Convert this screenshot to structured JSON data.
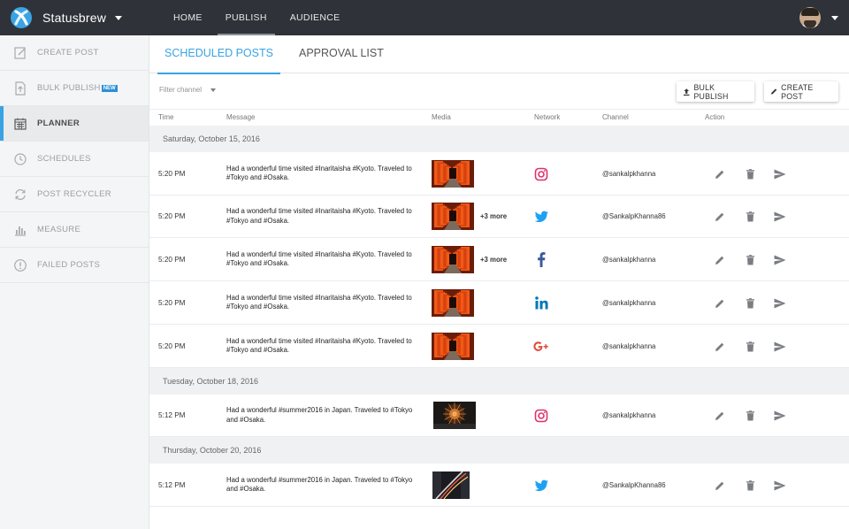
{
  "app": {
    "brand": "Statusbrew",
    "accent": "#3aa3e3",
    "nav": [
      {
        "label": "HOME"
      },
      {
        "label": "PUBLISH"
      },
      {
        "label": "AUDIENCE"
      }
    ]
  },
  "sidebar": {
    "items": [
      {
        "label": "CREATE POST",
        "icon": "edit-icon"
      },
      {
        "label": "BULK PUBLISH",
        "icon": "upload-file-icon",
        "badge": "NEW"
      },
      {
        "label": "PLANNER",
        "icon": "calendar-icon"
      },
      {
        "label": "SCHEDULES",
        "icon": "clock-icon"
      },
      {
        "label": "POST RECYCLER",
        "icon": "recycle-icon"
      },
      {
        "label": "MEASURE",
        "icon": "bar-chart-icon"
      },
      {
        "label": "FAILED POSTS",
        "icon": "alert-icon"
      }
    ]
  },
  "tabs": [
    {
      "label": "SCHEDULED POSTS"
    },
    {
      "label": "APPROVAL LIST"
    }
  ],
  "toolbar": {
    "filter_label": "Filter channel",
    "bulk_publish": "BULK PUBLISH",
    "create_post": "CREATE POST"
  },
  "columns": {
    "time": "Time",
    "message": "Message",
    "media": "Media",
    "network": "Network",
    "channel": "Channel",
    "action": "Action"
  },
  "groups": [
    {
      "date": "Saturday, October 15, 2016",
      "posts": [
        {
          "time": "5:20 PM",
          "message": "Had a wonderful time visited #Inaritaisha #Kyoto. Traveled to #Tokyo and #Osaka.",
          "media": "torii-gates",
          "more": "",
          "network": "instagram",
          "channel": "@sankalpkhanna"
        },
        {
          "time": "5:20 PM",
          "message": "Had a wonderful time visited #Inaritaisha #Kyoto. Traveled to #Tokyo and #Osaka.",
          "media": "torii-gates",
          "more": "+3 more",
          "network": "twitter",
          "channel": "@SankalpKhanna86"
        },
        {
          "time": "5:20 PM",
          "message": "Had a wonderful time visited #Inaritaisha #Kyoto. Traveled to #Tokyo and #Osaka.",
          "media": "torii-gates",
          "more": "+3 more",
          "network": "facebook",
          "channel": "@sankalpkhanna"
        },
        {
          "time": "5:20 PM",
          "message": "Had a wonderful time visited #Inaritaisha #Kyoto. Traveled to #Tokyo and #Osaka.",
          "media": "torii-gates",
          "more": "",
          "network": "linkedin",
          "channel": "@sankalpkhanna"
        },
        {
          "time": "5:20 PM",
          "message": "Had a wonderful time visited #Inaritaisha #Kyoto. Traveled to #Tokyo and #Osaka.",
          "media": "torii-gates",
          "more": "",
          "network": "google-plus",
          "channel": "@sankalpkhanna"
        }
      ]
    },
    {
      "date": "Tuesday, October 18, 2016",
      "posts": [
        {
          "time": "5:12 PM",
          "message": "Had a wonderful #summer2016 in Japan. Traveled to #Tokyo and #Osaka.",
          "media": "fireworks",
          "more": "",
          "network": "instagram",
          "channel": "@sankalpkhanna"
        }
      ]
    },
    {
      "date": "Thursday, October 20, 2016",
      "posts": [
        {
          "time": "5:12 PM",
          "message": "Had a wonderful #summer2016 in Japan. Traveled to #Tokyo and #Osaka.",
          "media": "night-traffic",
          "more": "",
          "network": "twitter",
          "channel": "@SankalpKhanna86"
        }
      ]
    }
  ],
  "network_colors": {
    "instagram": "#e1306c",
    "twitter": "#1da1f2",
    "facebook": "#3b5998",
    "linkedin": "#0077b5",
    "google-plus": "#dd4b39"
  }
}
